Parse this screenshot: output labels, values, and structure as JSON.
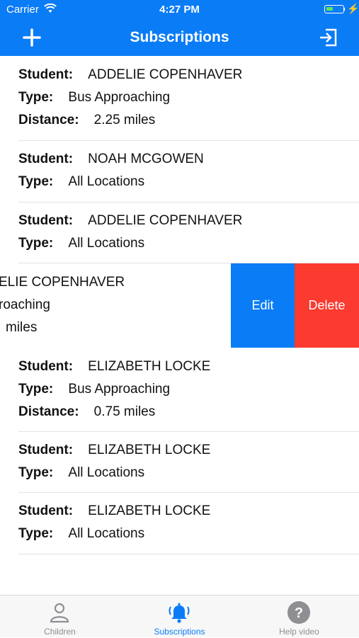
{
  "status_bar": {
    "carrier": "Carrier",
    "time": "4:27 PM"
  },
  "nav": {
    "title": "Subscriptions",
    "add_icon": "plus-icon",
    "logout_icon": "logout-icon"
  },
  "labels": {
    "student": "Student:",
    "type": "Type:",
    "distance": "Distance:"
  },
  "subscriptions": [
    {
      "student": "ADDELIE COPENHAVER",
      "type": "Bus Approaching",
      "distance": "2.25 miles"
    },
    {
      "student": "NOAH MCGOWEN",
      "type": "All Locations"
    },
    {
      "student": "ADDELIE COPENHAVER",
      "type": "All Locations"
    },
    {
      "student": "ELIE COPENHAVER",
      "type": "roaching",
      "distance": "miles"
    },
    {
      "student": "ELIZABETH LOCKE",
      "type": "Bus Approaching",
      "distance": "0.75 miles"
    },
    {
      "student": "ELIZABETH LOCKE",
      "type": "All Locations"
    },
    {
      "student": "ELIZABETH LOCKE",
      "type": "All Locations"
    }
  ],
  "swipe_actions": {
    "edit": "Edit",
    "delete": "Delete"
  },
  "tabs": [
    {
      "label": "Children",
      "icon": "person-icon",
      "active": false
    },
    {
      "label": "Subscriptions",
      "icon": "bell-icon",
      "active": true
    },
    {
      "label": "Help video",
      "icon": "help-icon",
      "active": false
    }
  ],
  "colors": {
    "accent": "#0a7cf6",
    "delete": "#fb3a30",
    "inactive_tab": "#8e8e93"
  }
}
